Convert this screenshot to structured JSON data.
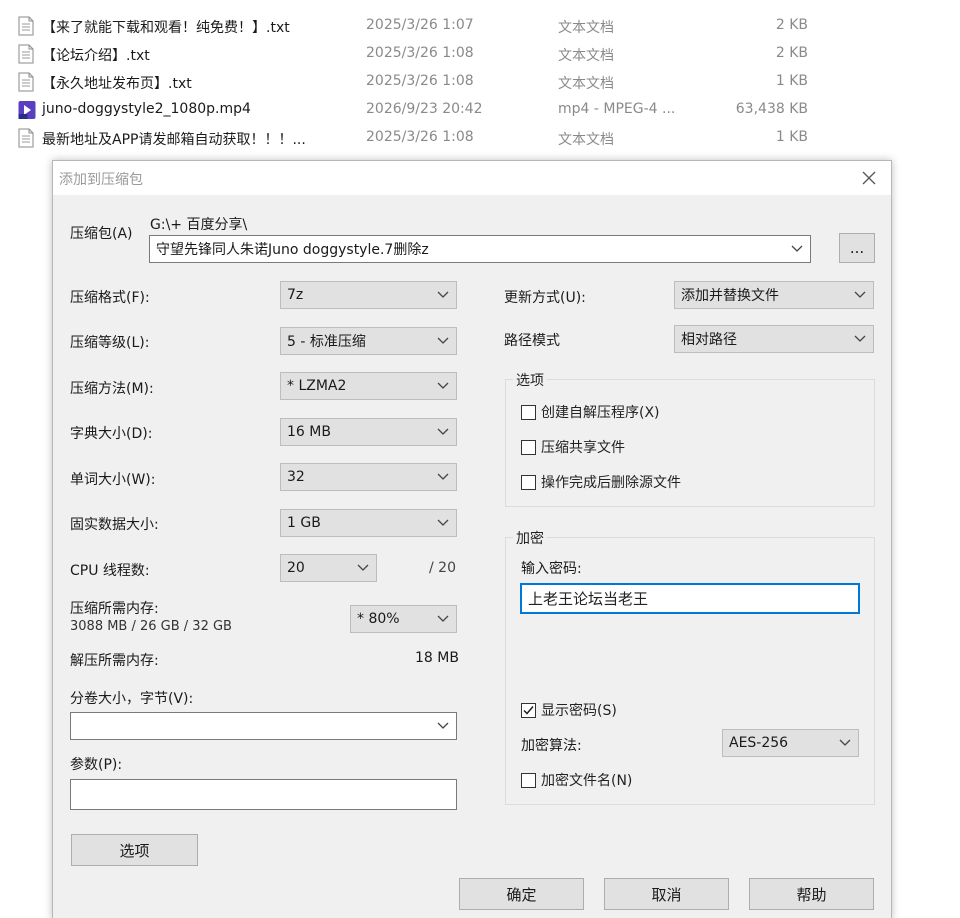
{
  "files": [
    {
      "name": "【来了就能下载和观看！纯免费！】.txt",
      "date": "2025/3/26 1:07",
      "type": "文本文档",
      "size": "2 KB",
      "icon": "text-file-icon"
    },
    {
      "name": "【论坛介绍】.txt",
      "date": "2025/3/26 1:08",
      "type": "文本文档",
      "size": "2 KB",
      "icon": "text-file-icon"
    },
    {
      "name": "【永久地址发布页】.txt",
      "date": "2025/3/26 1:08",
      "type": "文本文档",
      "size": "1 KB",
      "icon": "text-file-icon"
    },
    {
      "name": "juno-doggystyle2_1080p.mp4",
      "date": "2026/9/23 20:42",
      "type": "mp4 - MPEG-4 ...",
      "size": "63,438 KB",
      "icon": "video-file-icon"
    },
    {
      "name": "最新地址及APP请发邮箱自动获取！！！...",
      "date": "2025/3/26 1:08",
      "type": "文本文档",
      "size": "1 KB",
      "icon": "text-file-icon"
    }
  ],
  "dialog": {
    "title": "添加到压缩包",
    "archive": {
      "label": "压缩包(A)",
      "path": "G:\\+ 百度分享\\",
      "filename": "守望先锋同人朱诺Juno doggystyle.7删除z",
      "browse_label": "..."
    },
    "left": {
      "format": {
        "label": "压缩格式(F):",
        "value": "7z"
      },
      "level": {
        "label": "压缩等级(L):",
        "value": "5 - 标准压缩"
      },
      "method": {
        "label": "压缩方法(M):",
        "value": "* LZMA2"
      },
      "dict": {
        "label": "字典大小(D):",
        "value": "16 MB"
      },
      "word": {
        "label": "单词大小(W):",
        "value": "32"
      },
      "solid": {
        "label": "固实数据大小:",
        "value": "1 GB"
      },
      "cpu": {
        "label": "CPU 线程数:",
        "value": "20",
        "total": "/ 20"
      },
      "mem_compress": {
        "label": "压缩所需内存:",
        "detail": "3088 MB / 26 GB / 32 GB",
        "value": "* 80%"
      },
      "mem_decompress": {
        "label": "解压所需内存:",
        "value": "18 MB"
      },
      "volume": {
        "label": "分卷大小，字节(V):",
        "value": ""
      },
      "params": {
        "label": "参数(P):",
        "value": ""
      },
      "options_button": "选项"
    },
    "right": {
      "update": {
        "label": "更新方式(U):",
        "value": "添加并替换文件"
      },
      "path_mode": {
        "label": "路径模式",
        "value": "相对路径"
      },
      "options": {
        "title": "选项",
        "sfx": {
          "label": "创建自解压程序(X)",
          "checked": false
        },
        "shared": {
          "label": "压缩共享文件",
          "checked": false
        },
        "delete": {
          "label": "操作完成后删除源文件",
          "checked": false
        }
      },
      "encryption": {
        "title": "加密",
        "password_label": "输入密码:",
        "password": "上老王论坛当老王",
        "show_password": {
          "label": "显示密码(S)",
          "checked": true
        },
        "method_label": "加密算法:",
        "method": "AES-256",
        "encrypt_names": {
          "label": "加密文件名(N)",
          "checked": false
        }
      }
    },
    "buttons": {
      "ok": "确定",
      "cancel": "取消",
      "help": "帮助"
    }
  }
}
